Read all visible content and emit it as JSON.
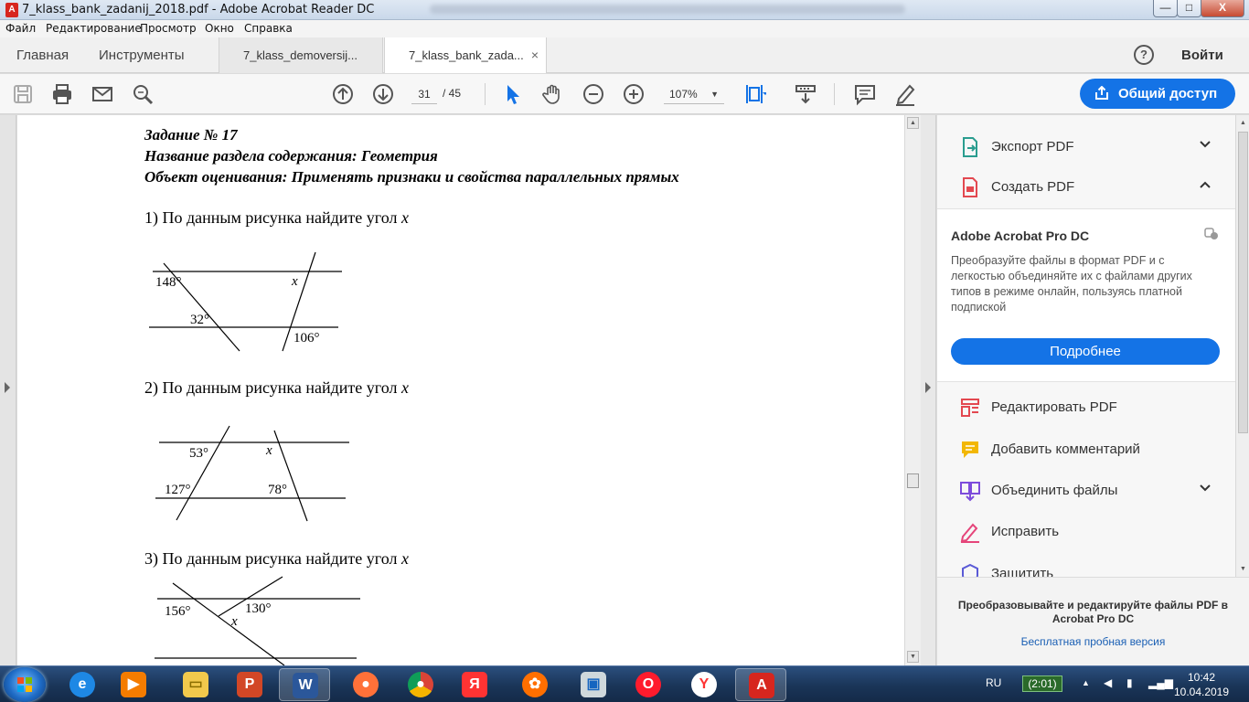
{
  "window": {
    "title": "7_klass_bank_zadanij_2018.pdf - Adobe Acrobat Reader DC",
    "minimize": "—",
    "maximize": "□",
    "close": "X"
  },
  "menu": [
    "Файл",
    "Редактирование",
    "Просмотр",
    "Окно",
    "Справка"
  ],
  "nav": {
    "home": "Главная",
    "tools": "Инструменты",
    "tabs": [
      {
        "label": "7_klass_demoversij..."
      },
      {
        "label": "7_klass_bank_zada..."
      }
    ],
    "tab_close": "×",
    "help": "?",
    "signin": "Войти"
  },
  "toolbar": {
    "page_current": "31",
    "page_total": "/ 45",
    "zoom": "107%",
    "share_label": "Общий доступ"
  },
  "document": {
    "heading1": "Задание № 17",
    "heading2": "Название раздела содержания: Геометрия",
    "heading3": "Объект оценивания: Применять признаки и свойства параллельных прямых",
    "q1": "1) По данным рисунка найдите угол",
    "q2": "2) По данным рисунка найдите угол",
    "q3": "3) По данным рисунка найдите угол",
    "var": "x",
    "fig1": {
      "a": "148°",
      "b": "32°",
      "c": "106°",
      "x": "x"
    },
    "fig2": {
      "a": "53°",
      "b": "127°",
      "c": "78°",
      "x": "x"
    },
    "fig3": {
      "a": "156°",
      "b": "130°",
      "x": "x"
    }
  },
  "panel": {
    "export": "Экспорт PDF",
    "create": "Создать PDF",
    "promo_title": "Adobe Acrobat Pro DC",
    "promo_text": "Преобразуйте файлы в формат PDF и с легкостью объединяйте их с файлами других типов в режиме онлайн, пользуясь платной подпиской",
    "promo_button": "Подробнее",
    "edit": "Редактировать PDF",
    "comment": "Добавить комментарий",
    "combine": "Объединить файлы",
    "fill": "Исправить",
    "protect": "Защитить",
    "footer_text": "Преобразовывайте и редактируйте файлы PDF в Acrobat Pro DC",
    "footer_link": "Бесплатная пробная версия"
  },
  "taskbar": {
    "lang": "RU",
    "timer": "(2:01)",
    "time": "10:42",
    "date": "10.04.2019"
  },
  "colors": {
    "accent": "#1473e6",
    "adobe_red": "#d7261e"
  }
}
